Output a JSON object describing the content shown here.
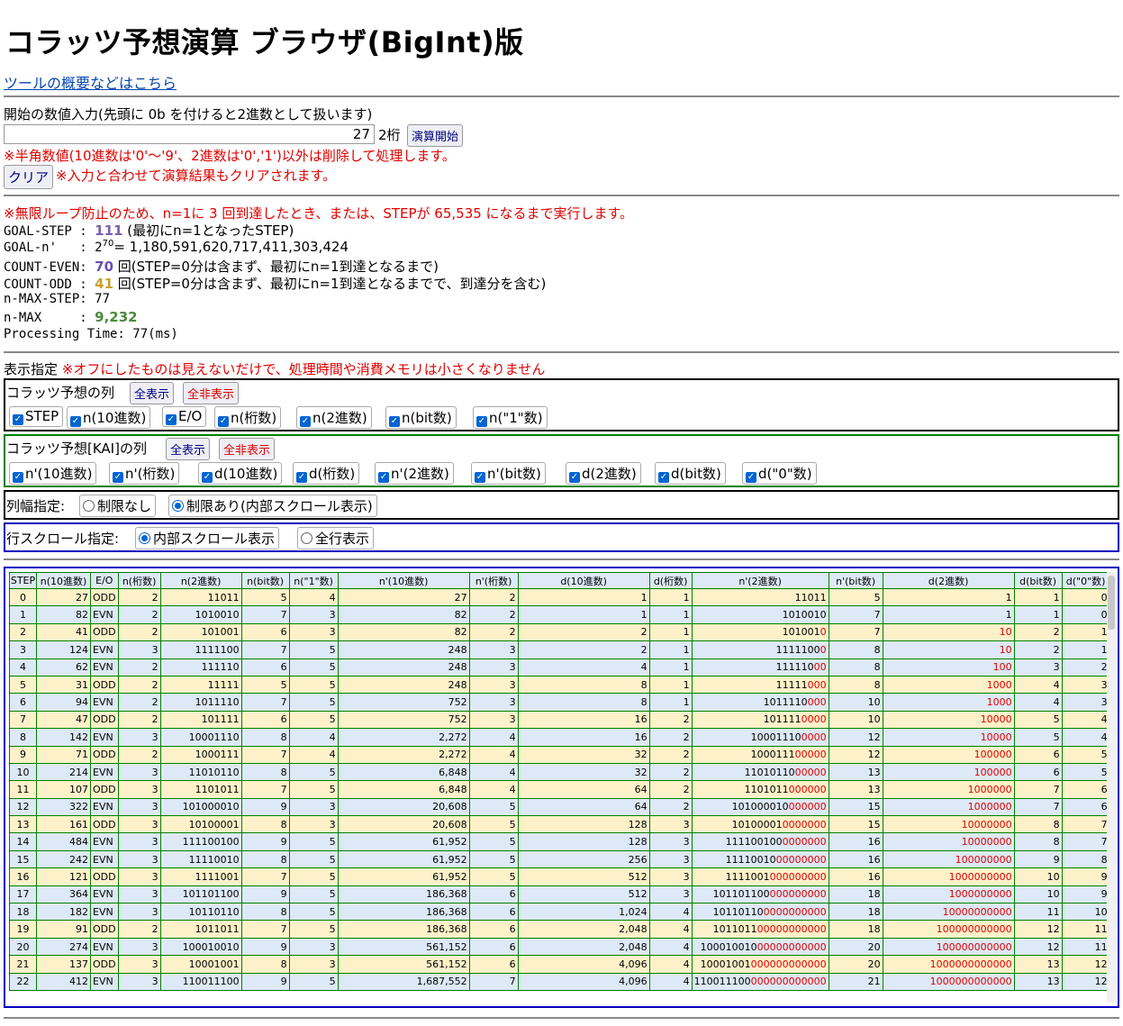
{
  "title": "コラッツ予想演算 ブラウザ(BigInt)版",
  "overview_link": "ツールの概要などはこちら",
  "input_section": {
    "label": "開始の数値入力(先頭に 0b を付けると2進数として扱います)",
    "value": "27",
    "digits": "2桁",
    "start_button": "演算開始",
    "warning": "※半角数値(10進数は'0'～'9'、2進数は'0','1')以外は削除して処理します。",
    "clear_button": "クリア",
    "clear_note": "※入力と合わせて演算結果もクリアされます。"
  },
  "results": {
    "loop_note": "※無限ループ防止のため、n=1に 3 回到達したとき、または、STEPが 65,535 になるまで実行します。",
    "goal_step_label": "GOAL-STEP : ",
    "goal_step_value": "111",
    "goal_step_note": " (最初にn=1となったSTEP)",
    "goal_n_label": "GOAL-n'   : 2",
    "goal_n_exp": "70",
    "goal_n_value": "= 1,180,591,620,717,411,303,424",
    "count_even_label": "COUNT-EVEN: ",
    "count_even_value": "70",
    "count_even_note": " 回(STEP=0分は含まず、最初にn=1到達となるまで)",
    "count_odd_label": "COUNT-ODD : ",
    "count_odd_value": "41",
    "count_odd_note": " 回(STEP=0分は含まず、最初にn=1到達となるまでで、到達分を含む)",
    "n_max_step": "n-MAX-STEP: 77",
    "n_max_label": "n-MAX     : ",
    "n_max_value": "9,232",
    "processing_time": "Processing Time: 77(ms)"
  },
  "display": {
    "label": "表示指定",
    "note": "※オフにしたものは見えないだけで、処理時間や消費メモリは小さくなりません",
    "collatz_cols_label": "コラッツ予想の列",
    "show_all": "全表示",
    "hide_all": "全非表示",
    "collatz_cols": [
      "STEP",
      "n(10進数)",
      "E/O",
      "n(桁数)",
      "n(2進数)",
      "n(bit数)",
      "n(\"1\"数)"
    ],
    "kai_cols_label": "コラッツ予想[KAI]の列",
    "kai_cols": [
      "n'(10進数)",
      "n'(桁数)",
      "d(10進数)",
      "d(桁数)",
      "n'(2進数)",
      "n'(bit数)",
      "d(2進数)",
      "d(bit数)",
      "d(\"0\"数)"
    ],
    "col_width_label": "列幅指定:",
    "col_width_opts": [
      "制限なし",
      "制限あり(内部スクロール表示)"
    ],
    "row_scroll_label": "行スクロール指定:",
    "row_scroll_opts": [
      "内部スクロール表示",
      "全行表示"
    ]
  },
  "table": {
    "headers": [
      "STEP",
      "n(10進数)",
      "E/O",
      "n(桁数)",
      "n(2進数)",
      "n(bit数)",
      "n(\"1\"数)",
      "n'(10進数)",
      "n'(桁数)",
      "d(10進数)",
      "d(桁数)",
      "n'(2進数)",
      "n'(bit数)",
      "d(2進数)",
      "d(bit数)",
      "d(\"0\"数)"
    ],
    "rows": [
      [
        "0",
        "27",
        "ODD",
        "2",
        "11011",
        "5",
        "4",
        "27",
        "2",
        "1",
        "1",
        "11011",
        "5",
        "1",
        "1",
        "0"
      ],
      [
        "1",
        "82",
        "EVN",
        "2",
        "1010010",
        "7",
        "3",
        "82",
        "2",
        "1",
        "1",
        "1010010",
        "7",
        "1",
        "1",
        "0"
      ],
      [
        "2",
        "41",
        "ODD",
        "2",
        "101001",
        "6",
        "3",
        "82",
        "2",
        "2",
        "1",
        "1010010",
        "7",
        "10",
        "2",
        "1"
      ],
      [
        "3",
        "124",
        "EVN",
        "3",
        "1111100",
        "7",
        "5",
        "248",
        "3",
        "2",
        "1",
        "11111000",
        "8",
        "10",
        "2",
        "1"
      ],
      [
        "4",
        "62",
        "EVN",
        "2",
        "111110",
        "6",
        "5",
        "248",
        "3",
        "4",
        "1",
        "11111000",
        "8",
        "100",
        "3",
        "2"
      ],
      [
        "5",
        "31",
        "ODD",
        "2",
        "11111",
        "5",
        "5",
        "248",
        "3",
        "8",
        "1",
        "11111000",
        "8",
        "1000",
        "4",
        "3"
      ],
      [
        "6",
        "94",
        "EVN",
        "2",
        "1011110",
        "7",
        "5",
        "752",
        "3",
        "8",
        "1",
        "1011110000",
        "10",
        "1000",
        "4",
        "3"
      ],
      [
        "7",
        "47",
        "ODD",
        "2",
        "101111",
        "6",
        "5",
        "752",
        "3",
        "16",
        "2",
        "1011110000",
        "10",
        "10000",
        "5",
        "4"
      ],
      [
        "8",
        "142",
        "EVN",
        "3",
        "10001110",
        "8",
        "4",
        "2,272",
        "4",
        "16",
        "2",
        "100011100000",
        "12",
        "10000",
        "5",
        "4"
      ],
      [
        "9",
        "71",
        "ODD",
        "2",
        "1000111",
        "7",
        "4",
        "2,272",
        "4",
        "32",
        "2",
        "100011100000",
        "12",
        "100000",
        "6",
        "5"
      ],
      [
        "10",
        "214",
        "EVN",
        "3",
        "11010110",
        "8",
        "5",
        "6,848",
        "4",
        "32",
        "2",
        "1101011000000",
        "13",
        "100000",
        "6",
        "5"
      ],
      [
        "11",
        "107",
        "ODD",
        "3",
        "1101011",
        "7",
        "5",
        "6,848",
        "4",
        "64",
        "2",
        "1101011000000",
        "13",
        "1000000",
        "7",
        "6"
      ],
      [
        "12",
        "322",
        "EVN",
        "3",
        "101000010",
        "9",
        "3",
        "20,608",
        "5",
        "64",
        "2",
        "101000010000000",
        "15",
        "1000000",
        "7",
        "6"
      ],
      [
        "13",
        "161",
        "ODD",
        "3",
        "10100001",
        "8",
        "3",
        "20,608",
        "5",
        "128",
        "3",
        "101000010000000",
        "15",
        "10000000",
        "8",
        "7"
      ],
      [
        "14",
        "484",
        "EVN",
        "3",
        "111100100",
        "9",
        "5",
        "61,952",
        "5",
        "128",
        "3",
        "1111001000000000",
        "16",
        "10000000",
        "8",
        "7"
      ],
      [
        "15",
        "242",
        "EVN",
        "3",
        "11110010",
        "8",
        "5",
        "61,952",
        "5",
        "256",
        "3",
        "1111001000000000",
        "16",
        "100000000",
        "9",
        "8"
      ],
      [
        "16",
        "121",
        "ODD",
        "3",
        "1111001",
        "7",
        "5",
        "61,952",
        "5",
        "512",
        "3",
        "1111001000000000",
        "16",
        "1000000000",
        "10",
        "9"
      ],
      [
        "17",
        "364",
        "EVN",
        "3",
        "101101100",
        "9",
        "5",
        "186,368",
        "6",
        "512",
        "3",
        "101101100000000000",
        "18",
        "1000000000",
        "10",
        "9"
      ],
      [
        "18",
        "182",
        "EVN",
        "3",
        "10110110",
        "8",
        "5",
        "186,368",
        "6",
        "1,024",
        "4",
        "101101100000000000",
        "18",
        "10000000000",
        "11",
        "10"
      ],
      [
        "19",
        "91",
        "ODD",
        "2",
        "1011011",
        "7",
        "5",
        "186,368",
        "6",
        "2,048",
        "4",
        "101101100000000000",
        "18",
        "100000000000",
        "12",
        "11"
      ],
      [
        "20",
        "274",
        "EVN",
        "3",
        "100010010",
        "9",
        "3",
        "561,152",
        "6",
        "2,048",
        "4",
        "10001001000000000000",
        "20",
        "100000000000",
        "12",
        "11"
      ],
      [
        "21",
        "137",
        "ODD",
        "3",
        "10001001",
        "8",
        "3",
        "561,152",
        "6",
        "4,096",
        "4",
        "10001001000000000000",
        "20",
        "1000000000000",
        "13",
        "12"
      ],
      [
        "22",
        "412",
        "EVN",
        "3",
        "110011100",
        "9",
        "5",
        "1,687,552",
        "7",
        "4,096",
        "4",
        "110011100000000000000",
        "21",
        "1000000000000",
        "13",
        "12"
      ]
    ]
  },
  "colors": {
    "accent_blue": "#0000c0",
    "green_border": "#008000",
    "red_text": "#e00000",
    "odd_row": "#fdf1c9",
    "even_row": "#dde9f6"
  }
}
